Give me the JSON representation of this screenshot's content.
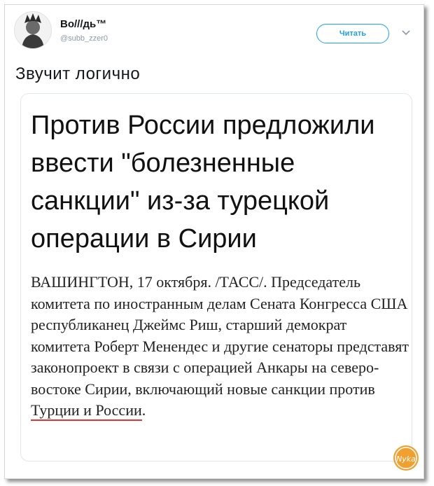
{
  "tweet": {
    "display_name": "Во///дь™",
    "handle": "@subb_zzer0",
    "follow_label": "Читать",
    "text": "Звучит логично"
  },
  "card": {
    "headline": "Против России предложили ввести \"болезненные санкции\" из-за турецкой операции в Сирии",
    "body_before": "ВАШИНГТОН, 17 октября. /ТАСС/. Председатель комитета по иностранным делам Сената Конгресса США республиканец Джеймс Риш, старший демократ комитета Роберт Менендес и другие сенаторы представят законопроект в связи с операцией Анкары на северо-востоке Сирии, включающий новые санкции против ",
    "body_underlined": "Турции и России",
    "body_after": "."
  },
  "watermark": {
    "text": "Nyka"
  },
  "colors": {
    "accent": "#1da1f2",
    "underline": "#e3342f",
    "watermark": "#f0a030"
  },
  "icons": {
    "caret": "chevron-down-icon",
    "avatar": "avatar"
  }
}
